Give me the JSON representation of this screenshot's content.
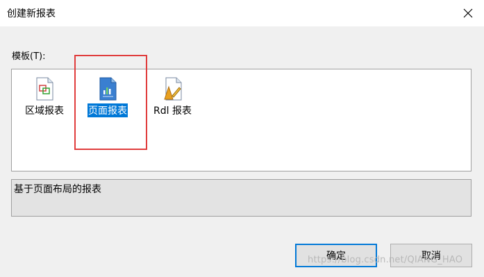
{
  "window": {
    "title": "创建新报表",
    "close_glyph": "✕"
  },
  "templates_label": "模板(T):",
  "templates": [
    {
      "label": "区域报表",
      "icon": "area-report-icon",
      "selected": false
    },
    {
      "label": "页面报表",
      "icon": "page-report-icon",
      "selected": true
    },
    {
      "label": "Rdl 报表",
      "icon": "rdl-report-icon",
      "selected": false
    }
  ],
  "description": "基于页面布局的报表",
  "buttons": {
    "ok": "确定",
    "cancel": "取消"
  },
  "watermark": "https://blog.csdn.net/QIANG_HAO",
  "colors": {
    "selection": "#0078d7",
    "highlight": "#e03c3c"
  }
}
